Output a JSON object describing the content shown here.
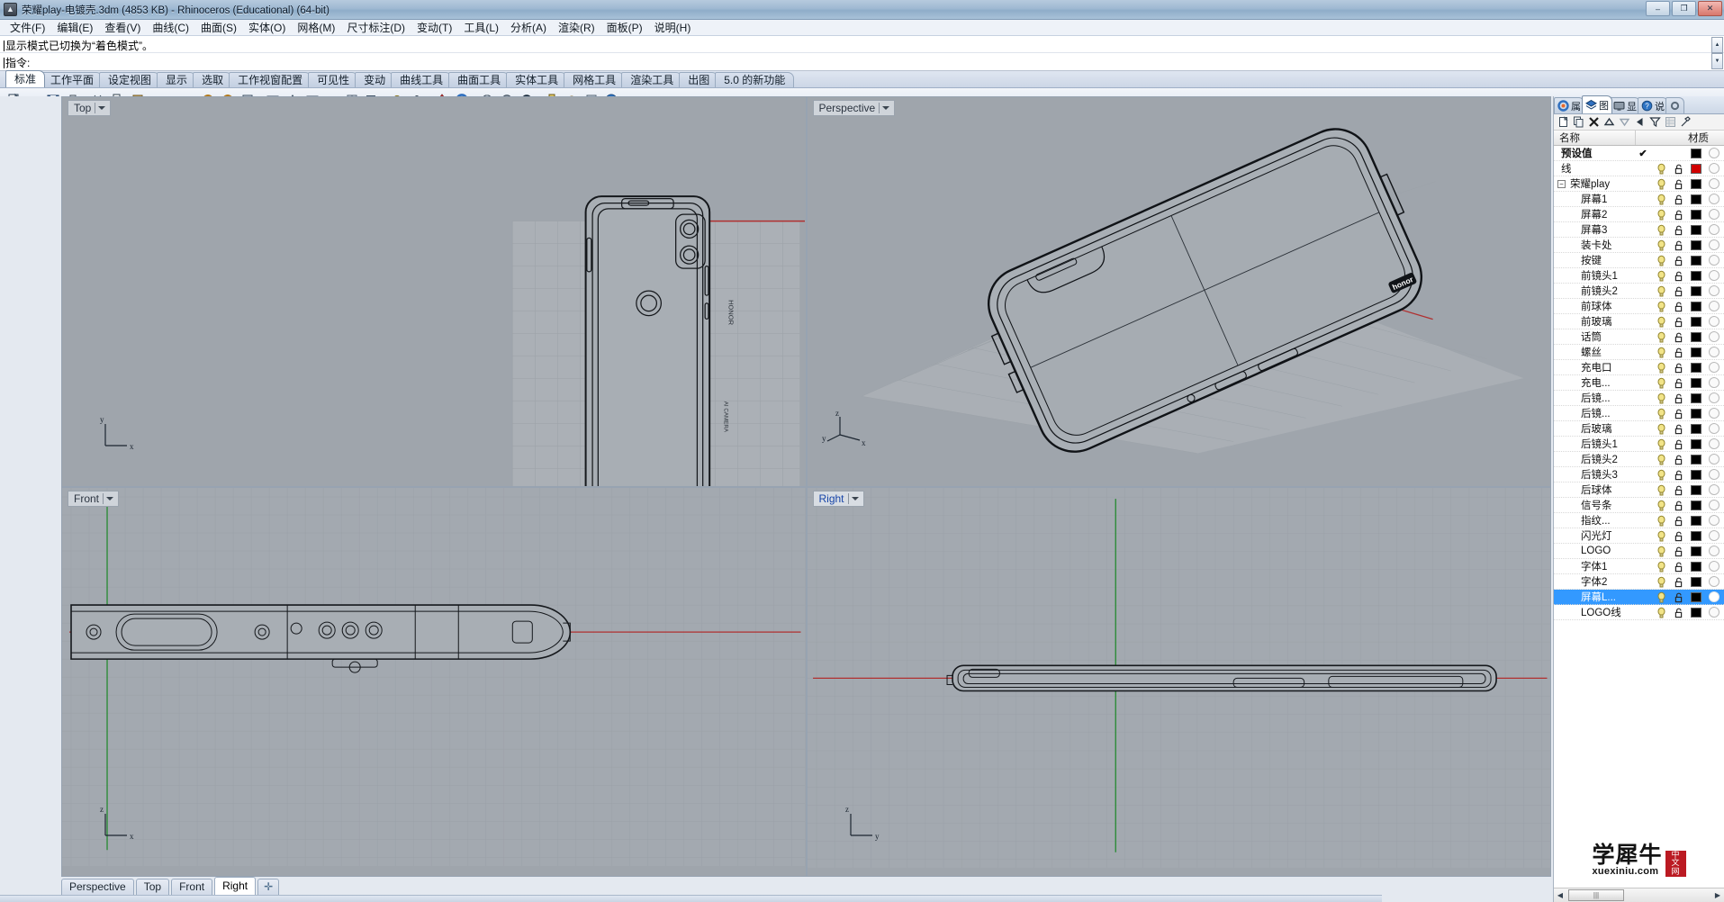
{
  "window": {
    "title": "荣耀play-电镀壳.3dm (4853 KB) - Rhinoceros (Educational) (64-bit)",
    "minimize": "–",
    "maximize": "❐",
    "close": "✕"
  },
  "menu": {
    "items": [
      "文件(F)",
      "编辑(E)",
      "查看(V)",
      "曲线(C)",
      "曲面(S)",
      "实体(O)",
      "网格(M)",
      "尺寸标注(D)",
      "变动(T)",
      "工具(L)",
      "分析(A)",
      "渲染(R)",
      "面板(P)",
      "说明(H)"
    ]
  },
  "command": {
    "history_line": "显示模式已切换为“着色模式”。",
    "prompt_label": "指令:",
    "prompt_value": ""
  },
  "toolbar_tabs": {
    "items": [
      "标准",
      "工作平面",
      "设定视图",
      "显示",
      "选取",
      "工作视窗配置",
      "可见性",
      "变动",
      "曲线工具",
      "曲面工具",
      "实体工具",
      "网格工具",
      "渲染工具",
      "出图",
      "5.0 的新功能"
    ],
    "active": "标准"
  },
  "viewports": {
    "top": {
      "label": "Top",
      "active": false
    },
    "persp": {
      "label": "Perspective",
      "active": false
    },
    "front": {
      "label": "Front",
      "active": false
    },
    "right": {
      "label": "Right",
      "active": true
    }
  },
  "viewport_tabs": {
    "items": [
      "Perspective",
      "Top",
      "Front",
      "Right"
    ],
    "active": "Right",
    "add_label": "✛"
  },
  "panel": {
    "tabs": [
      {
        "label": "属",
        "icon": "color-wheel-icon",
        "active": false
      },
      {
        "label": "图",
        "icon": "layers-icon",
        "active": true
      },
      {
        "label": "显",
        "icon": "display-icon",
        "active": false
      },
      {
        "label": "说",
        "icon": "help-icon",
        "active": false
      }
    ],
    "tools": [
      "new-layer-icon",
      "copy-layer-icon",
      "delete-layer-icon",
      "move-up-icon",
      "move-down-icon",
      "move-left-icon",
      "filter-icon",
      "properties-icon",
      "tools-icon"
    ],
    "columns": {
      "name": "名称",
      "material": "材质"
    },
    "layers": [
      {
        "name": "预设值",
        "depth": 0,
        "bold": true,
        "current": true,
        "light": false,
        "lock": false,
        "color": "#000000",
        "material": false,
        "selected": false,
        "expander": ""
      },
      {
        "name": "线",
        "depth": 0,
        "bold": false,
        "current": false,
        "light": true,
        "lock": true,
        "color": "#d00000",
        "material": false,
        "selected": false,
        "expander": ""
      },
      {
        "name": "荣耀play",
        "depth": 0,
        "bold": false,
        "current": false,
        "light": true,
        "lock": true,
        "color": "#000000",
        "material": false,
        "selected": false,
        "expander": "−"
      },
      {
        "name": "屏幕1",
        "depth": 1,
        "bold": false,
        "current": false,
        "light": true,
        "lock": true,
        "color": "#000000",
        "material": false,
        "selected": false,
        "expander": ""
      },
      {
        "name": "屏幕2",
        "depth": 1,
        "bold": false,
        "current": false,
        "light": true,
        "lock": true,
        "color": "#000000",
        "material": false,
        "selected": false,
        "expander": ""
      },
      {
        "name": "屏幕3",
        "depth": 1,
        "bold": false,
        "current": false,
        "light": true,
        "lock": true,
        "color": "#000000",
        "material": false,
        "selected": false,
        "expander": ""
      },
      {
        "name": "装卡处",
        "depth": 1,
        "bold": false,
        "current": false,
        "light": true,
        "lock": true,
        "color": "#000000",
        "material": false,
        "selected": false,
        "expander": ""
      },
      {
        "name": "按键",
        "depth": 1,
        "bold": false,
        "current": false,
        "light": true,
        "lock": true,
        "color": "#000000",
        "material": false,
        "selected": false,
        "expander": ""
      },
      {
        "name": "前镜头1",
        "depth": 1,
        "bold": false,
        "current": false,
        "light": true,
        "lock": true,
        "color": "#000000",
        "material": false,
        "selected": false,
        "expander": ""
      },
      {
        "name": "前镜头2",
        "depth": 1,
        "bold": false,
        "current": false,
        "light": true,
        "lock": true,
        "color": "#000000",
        "material": false,
        "selected": false,
        "expander": ""
      },
      {
        "name": "前球体",
        "depth": 1,
        "bold": false,
        "current": false,
        "light": true,
        "lock": true,
        "color": "#000000",
        "material": false,
        "selected": false,
        "expander": ""
      },
      {
        "name": "前玻璃",
        "depth": 1,
        "bold": false,
        "current": false,
        "light": true,
        "lock": true,
        "color": "#000000",
        "material": false,
        "selected": false,
        "expander": ""
      },
      {
        "name": "话筒",
        "depth": 1,
        "bold": false,
        "current": false,
        "light": true,
        "lock": true,
        "color": "#000000",
        "material": false,
        "selected": false,
        "expander": ""
      },
      {
        "name": "螺丝",
        "depth": 1,
        "bold": false,
        "current": false,
        "light": true,
        "lock": true,
        "color": "#000000",
        "material": false,
        "selected": false,
        "expander": ""
      },
      {
        "name": "充电口",
        "depth": 1,
        "bold": false,
        "current": false,
        "light": true,
        "lock": true,
        "color": "#000000",
        "material": false,
        "selected": false,
        "expander": ""
      },
      {
        "name": "充电...",
        "depth": 1,
        "bold": false,
        "current": false,
        "light": true,
        "lock": true,
        "color": "#000000",
        "material": false,
        "selected": false,
        "expander": ""
      },
      {
        "name": "后镜...",
        "depth": 1,
        "bold": false,
        "current": false,
        "light": true,
        "lock": true,
        "color": "#000000",
        "material": false,
        "selected": false,
        "expander": ""
      },
      {
        "name": "后镜...",
        "depth": 1,
        "bold": false,
        "current": false,
        "light": true,
        "lock": true,
        "color": "#000000",
        "material": false,
        "selected": false,
        "expander": ""
      },
      {
        "name": "后玻璃",
        "depth": 1,
        "bold": false,
        "current": false,
        "light": true,
        "lock": true,
        "color": "#000000",
        "material": false,
        "selected": false,
        "expander": ""
      },
      {
        "name": "后镜头1",
        "depth": 1,
        "bold": false,
        "current": false,
        "light": true,
        "lock": true,
        "color": "#000000",
        "material": false,
        "selected": false,
        "expander": ""
      },
      {
        "name": "后镜头2",
        "depth": 1,
        "bold": false,
        "current": false,
        "light": true,
        "lock": true,
        "color": "#000000",
        "material": false,
        "selected": false,
        "expander": ""
      },
      {
        "name": "后镜头3",
        "depth": 1,
        "bold": false,
        "current": false,
        "light": true,
        "lock": true,
        "color": "#000000",
        "material": false,
        "selected": false,
        "expander": ""
      },
      {
        "name": "后球体",
        "depth": 1,
        "bold": false,
        "current": false,
        "light": true,
        "lock": true,
        "color": "#000000",
        "material": false,
        "selected": false,
        "expander": ""
      },
      {
        "name": "信号条",
        "depth": 1,
        "bold": false,
        "current": false,
        "light": true,
        "lock": true,
        "color": "#000000",
        "material": false,
        "selected": false,
        "expander": ""
      },
      {
        "name": "指纹...",
        "depth": 1,
        "bold": false,
        "current": false,
        "light": true,
        "lock": true,
        "color": "#000000",
        "material": false,
        "selected": false,
        "expander": ""
      },
      {
        "name": "闪光灯",
        "depth": 1,
        "bold": false,
        "current": false,
        "light": true,
        "lock": true,
        "color": "#000000",
        "material": false,
        "selected": false,
        "expander": ""
      },
      {
        "name": "LOGO",
        "depth": 1,
        "bold": false,
        "current": false,
        "light": true,
        "lock": true,
        "color": "#000000",
        "material": false,
        "selected": false,
        "expander": ""
      },
      {
        "name": "字体1",
        "depth": 1,
        "bold": false,
        "current": false,
        "light": true,
        "lock": true,
        "color": "#000000",
        "material": false,
        "selected": false,
        "expander": ""
      },
      {
        "name": "字体2",
        "depth": 1,
        "bold": false,
        "current": false,
        "light": true,
        "lock": true,
        "color": "#000000",
        "material": false,
        "selected": false,
        "expander": ""
      },
      {
        "name": "屏幕L...",
        "depth": 1,
        "bold": false,
        "current": false,
        "light": true,
        "lock": true,
        "color": "#000000",
        "material": true,
        "selected": true,
        "expander": ""
      },
      {
        "name": "LOGO线",
        "depth": 1,
        "bold": false,
        "current": false,
        "light": true,
        "lock": true,
        "color": "#000000",
        "material": false,
        "selected": false,
        "expander": ""
      }
    ],
    "brand": {
      "zh": "学犀牛",
      "domain": "xuexiniu.com",
      "badge": "中文网"
    },
    "scrollbar": {
      "left_arrow": "◀",
      "right_arrow": "▶",
      "grip": "|||"
    }
  },
  "colors": {
    "viewport_bg": "#9fa5ac",
    "selection": "#3399ff",
    "x_axis": "#b03030",
    "y_axis": "#2f8c3a",
    "layer_red": "#d00000",
    "brand_red": "#bb1a22"
  }
}
